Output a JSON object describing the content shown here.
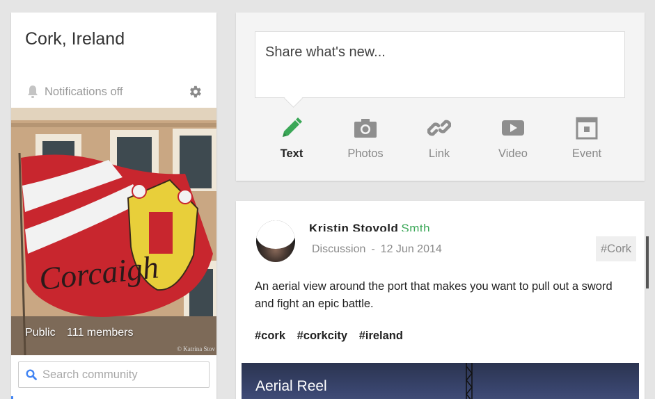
{
  "community": {
    "title": "Cork, Ireland",
    "notifications_label": "Notifications off",
    "visibility": "Public",
    "members": "111 members",
    "photo_text": "Corcaigh",
    "photo_credit": "© Katrina Stov",
    "search_placeholder": "Search community"
  },
  "share": {
    "prompt": "Share what's new...",
    "actions": [
      {
        "label": "Text",
        "icon": "pencil-icon"
      },
      {
        "label": "Photos",
        "icon": "camera-icon"
      },
      {
        "label": "Link",
        "icon": "link-icon"
      },
      {
        "label": "Video",
        "icon": "video-icon"
      },
      {
        "label": "Event",
        "icon": "event-icon"
      }
    ]
  },
  "post": {
    "author": "Kristin Stovold",
    "author_tail": "Smth",
    "category": "Discussion",
    "date": "12 Jun 2014",
    "tag_chip": "#Cork",
    "body": "An aerial view around the port that makes you want to pull out a sword and fight an epic battle.",
    "hashtags": [
      "#cork",
      "#corkcity",
      "#ireland"
    ],
    "media_title": "Aerial Reel"
  },
  "colors": {
    "accent_green": "#3aa757",
    "accent_blue": "#4285f4"
  }
}
